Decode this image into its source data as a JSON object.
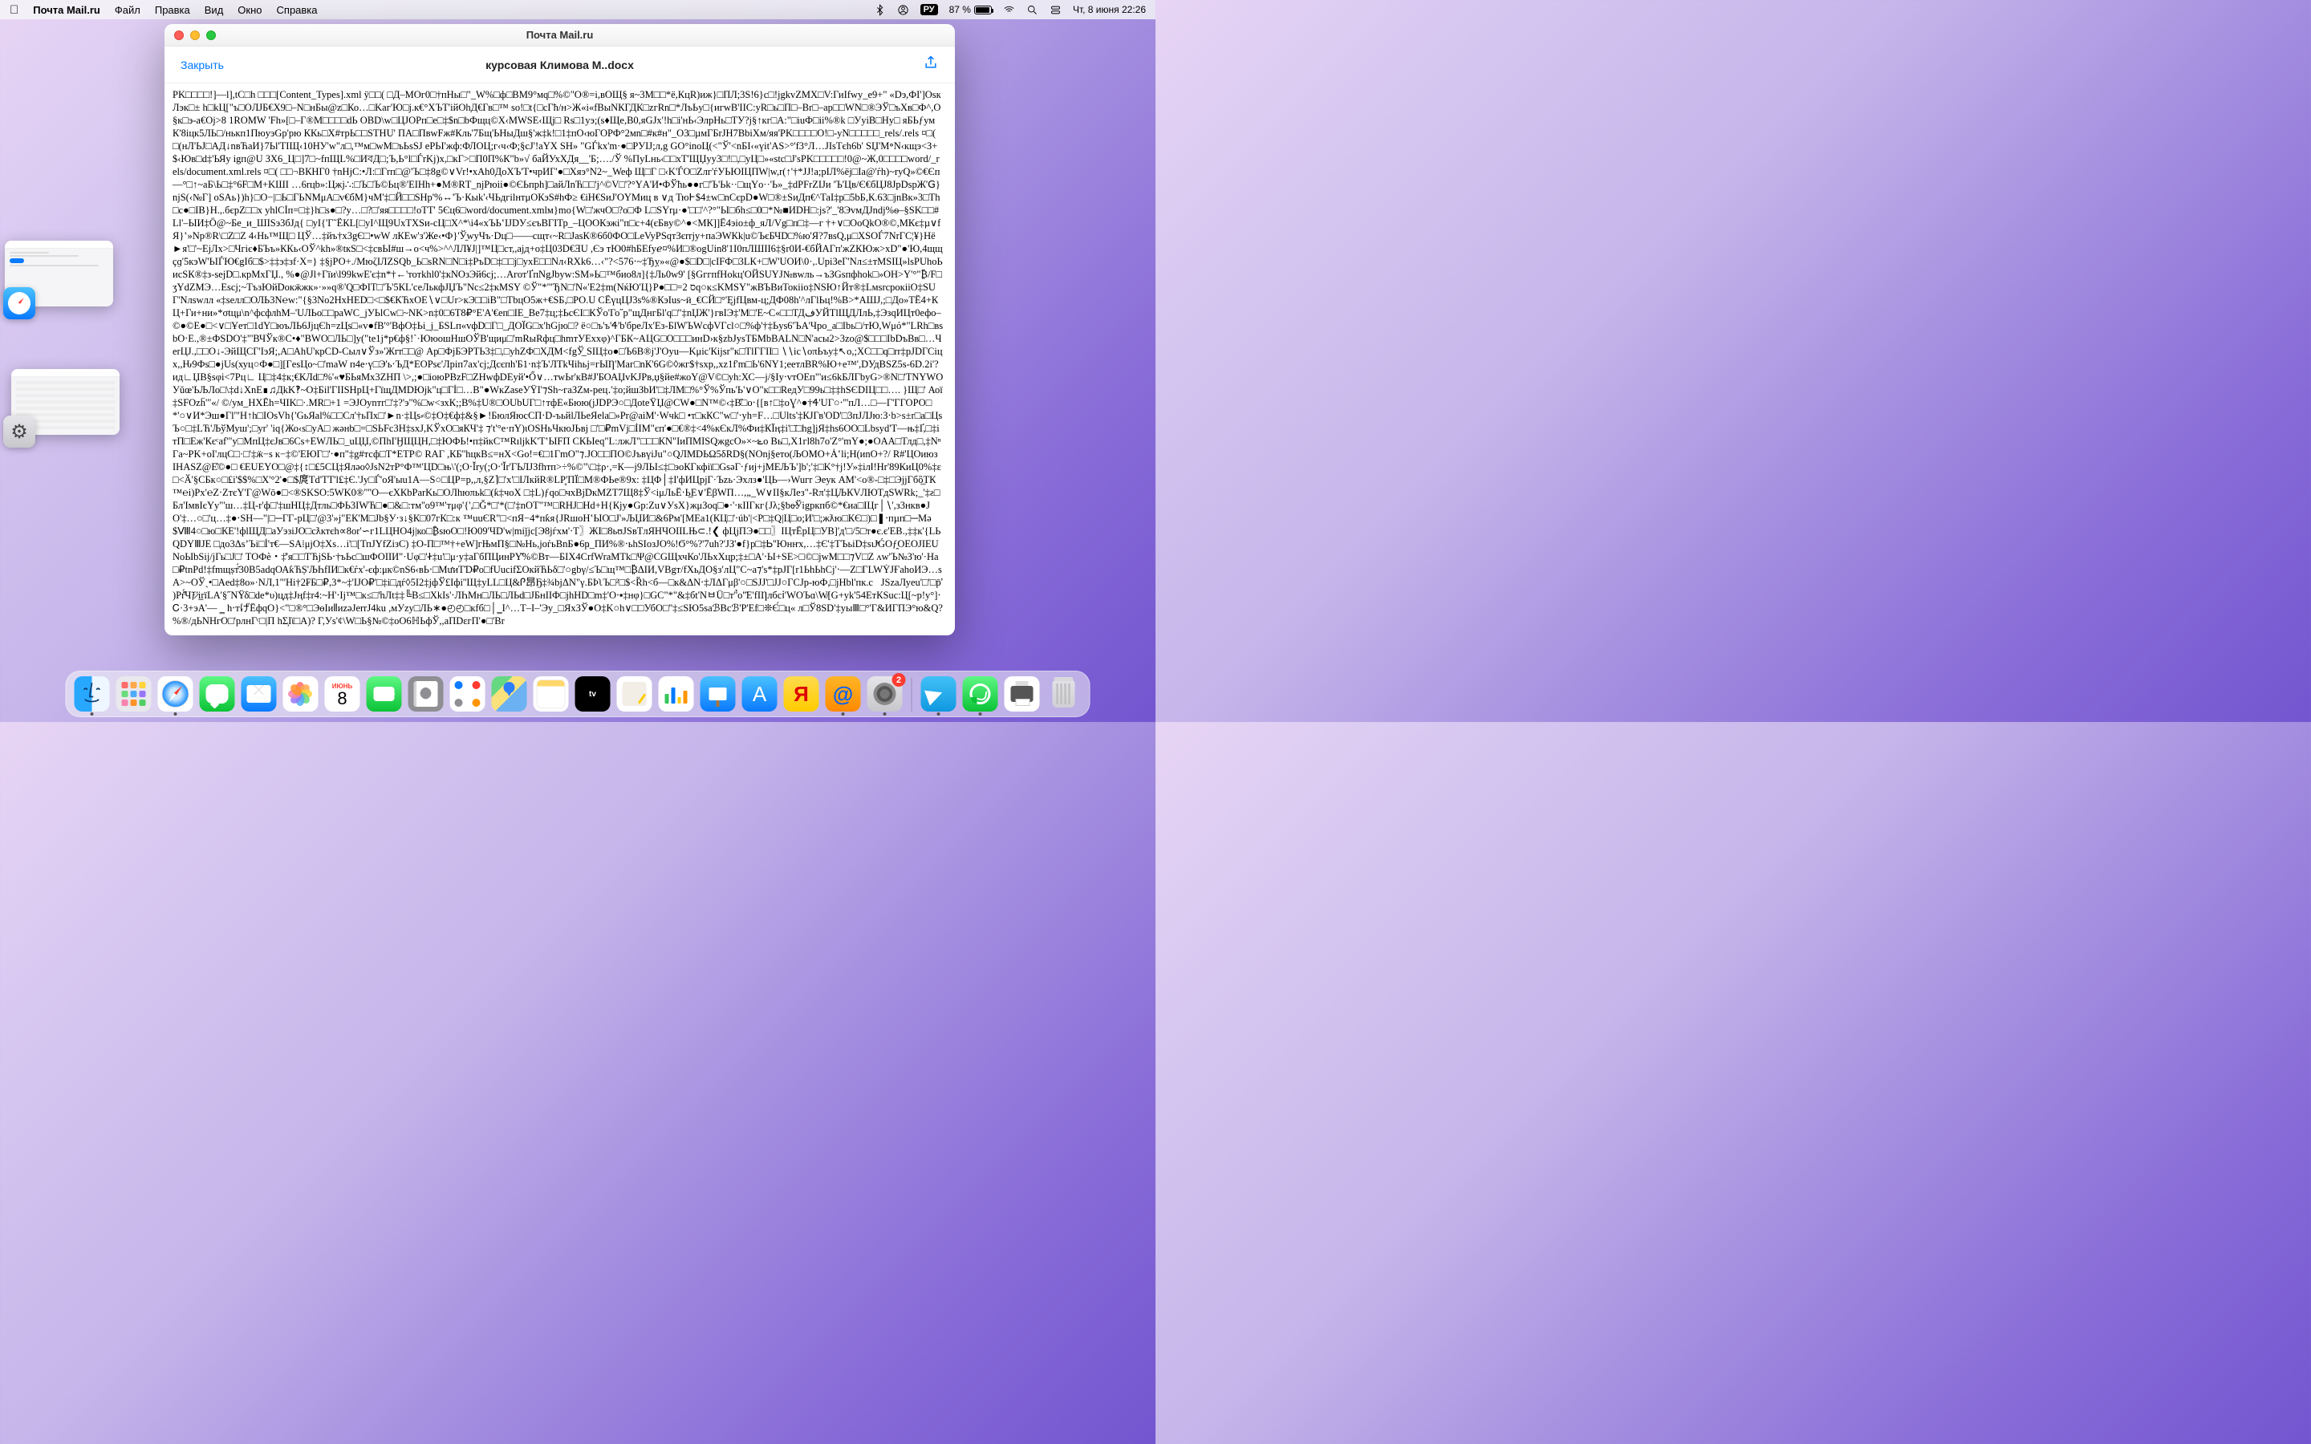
{
  "menubar": {
    "app_name": "Почта Mail.ru",
    "menus": [
      "Файл",
      "Правка",
      "Вид",
      "Окно",
      "Справка"
    ],
    "battery_percent": "87 %",
    "input_lang": "РУ",
    "clock": "Чт, 8 июня  22:26"
  },
  "window": {
    "title": "Почта Mail.ru",
    "close_label": "Закрыть",
    "filename": "курсовая Климова М..docx",
    "body": "PK□□□□!]—l],tC□h □□□[Content_Types].xml ÿ□□( □Д–МОг0□†пHы□\"_W%□ф□ВМ9°мq□%©\"O®=i,вОЩ§ я~3М□□*ё,КцR)иж}□ПЛ;3S!6}c□!jgkvZMX□V:ГиIfwy_е9+\" «Dэ,ФI']OsкЛэк□± h□kЦ[\"ъ□OЛJБ€X9□–N□нБы@z□Ко…□Kаг'Ю□j.к€°XЪТ'iйОhД€Гв□™ so!□t{□сГћ/н>Ж«i«fВыNКГДК□zгRn□*ЛъЬу□{игwВ'IIС:уR□ь□П□–Br□–ар□□WN□®ЭЎ□ъХв□Ф^,О§к□э-а€Oj>8 1ROMW 'Fh»[□–Г®М□□□□dЬ OBD\\w□ЦJOPп□e□‡$n□bФщц©Х‹MWSE‹Щj□ Rs□1уэ;(s♦Щe,B0,яGJx'!h□і'нЬ‹ЭлpHь□ТУ?j§↑кг□А:\"□іuФ□іi%®k □УуіВ□Ну□ яБЬƒумК'8іцк5ЛЬ□/нькп1ПюуэGр'рю ККь□Х#трЬ□□STHU' ПА□ПвwFж#Кль'7Бщ'ЬНыДш§'ж‡k!□1‡пО‹юГОРФ°2мn□#к#н\"_О3□µмГБrJH7BbiXм/яя'PK□□□□О!□-yN□□□□□_rels/.rels ¤□( □(нЛ'ЬJ□АД↓nвЋаИ}7Ьl'ТІЩ‹10НУ'w\"л□,™м□wM□ъЬsSJ ePЬI'жф:ФЛОЦ;г‹ч‹Ф;§сЈ'!аҮХ SH» \"GЃkx'm·●□PУIЈ;л,g GO°inоЦ(<\"Ў'<nБI‹«үіt'АЅ>°'f3°Л…JIsТєh6b' SЏ'M॰N‹кщэ<З+$‹Юв□d‡'ЬЯу igп@U ЗХ6_Ц□]7□~fпЩL%□ИবД□;Ъ,Ь°l□ЃrKj)х,□кГ>□П0П%К\"b»√ баЙУхХДя__'Б;…./Ў %ПуLнь‹□□хТ'ЩЏуу3□!□,□уЦ□»«stс□J'sPK□□□□□!0@~Ж,0□□□□word/_rels/document.xml.rels ¤□( □□¬ВКНГ0 †nHjС:•Л:□Гrп□@'Ъ□‡8g©∨Vr!•xAh0ДoХЪ'Т•чрИГ'●□Хяэ°N2~_Weф Щ□Г □‹K'ЃO□Zлг'ѓУЬЮІЦПW|w,r(↑'†*JJ!а;pIЛ%ёj□Iа@'ѓh)~ryQ»©€Єп—°□↑~аБ\\Ь□‡°6F□M+KШI …6rцb»:Цжj∴:□Ъ□Ъ©Ьц®'EIHh+●M®RТ_njРюii●©ЄЬпph]□айЛnЋ□□'j^©V□'?°ҮA'И•ФЎћь●●г□'Ъ'Ьk··□щҮо··'Ь»_‡dPFrZIJи 'Ъ'Цв/Є€бЦJ8JрDѕрЖ'ꓖ}njS(‹№Г] oSAь})h}□О−|□Ь□ГЬNМμА□v€бМ}чМ'‡□Й□□SHр'%↔'Ъ·Кыk'‹ЧЬдгilнтμОКэS#hФ≥ €іН€ЅиЈ'ОҮМиц в ∨д ТюͰ$4±w□nCєрD●W□®±SиДп€^ТаІ‡р□5bБ,К.63□јnВк»3□Тh□c●□IB}Н.,.бєpZ□□x yhlCİп=□‡}h□s●□?у…□?□'яя□□□□!oTT' 5Єц6□word/document.xmlм}mo{W□'жчО□?o□Ф L□SYrμ·●'□□'^?°\"Ы□бh≤□0□*№■ИDH□:js?'_'8ЭvмДJndj%ѳ–§SK□□#Ll'–ЫИ‡Ӧ@~Бe_и_ШIЅэ3бЈд{ □уI{'Г˜ЁКL[□уI^Щ9UхТХЅи-сЦ□X^*\\i4«хЪЬ‛IЈDУ≤єъВГIТр_–ЦООКэжi\"п□с+4(єБʙу©^●<МК]]Ё4эіо±ф_яЛ/Vg□п□‡—г †+∨□OоQkO®©,МКє‡µ∨fЯ}‛»Np®R\\□Z□Z 4‹Нь™Щ□ ЦЎ…‡йъ†х3gЄ□•wW лКЕw'з'Же‹•Ф}'Ў̱wуЧъ·Dц□――cщт‹~R□JasК®6б0ФО□LeVyPSqтЗєrrjу+паЭWКk|u©ЪєБЧD□%ю'Я?7вsQ,μ□XSOЃ7NrГC¦¥}Нё►я'□'~ЕjЛх>□Чгiє♦БЪъ»ККь‹OЎ^kh»®tкЅ□<‡свЫ#ш→о<ч%>^^ЛЛ¥J|]™Ц□ст,,ajд+о‡Ц03D€ƎU ,Єэ тЮ0#hБEfуℯ¤%И□®оgUin8'1I0пЛШII6‡§r0И-€бЙАГп'жZКЮж>хD\"●'Ю,4щщçɡ'5кэW'ЬIЃЮ€gIб□$>‡‡э‡зf·Х=} ‡§jРО+./МюζІЛZSQb_Ь□sRN□N□і‡РъD□‡□□j□уxE□□Nл‹RXk6…‹\"?<576‧~‡Ђỵ»«@●$□D□|сIFФ□3LК+□W'UOИ\\0·,.UpiЗеГ'Nл≤±тМSIЦ»lsPUhоЬиcSК®‡з-sejD□.крМхГЏ., %●@Jl+Гїи\\l99kwE'є‡n*†←'тотkhl0'‡кNOзЭй6сj;…Aгот'ҐпNgJbуw:SМ»Ь□™био8л]{‡Ль0w9' [§GггпfНоkц'ОЙSUΥЈ№вwль→ъЗGsпфhok□»OH>Y'°\"₿/F□ʒҮdZМЭ…Esсj;~ТъзЮйDoкӝжк»·»»q®'Q□ФIТ□'Ъ'5КL'сеЛькфJЏЪ\"Nс≤2‡кMSY ©Ў\"*\"'ЂN□'N«'Е2‡m(NќЮ'Ц}Р●□□=2 סq○ĸ≤KMSY\"жВЪВиТокiiо‡NЅЮ↑Йт®‡LмsrcрокiiO‡SUГ'Nлswлл «‡sелл□ОЛЬ3N℮w:\"{§3No2HxHED□<□$€КЋхОE∖∨□Ur>кЭ□□iB\"□ТbцO5ж+€SБ,□PO.U СЁүцЦЈ3s%®КэIus~ӥ_€СЙ□°'ĘjfЦвм-ц;ДФ08h'^лГlЬц!%В>*АШJ,;□Дo»TЁ4+КЦ+Ги+ни»*σtцμ\\n^фcфлhМ–'UЛЬo□□paWС_jУЬlCw□~NK>n‡0□6Т8₽°E'A'€еп□IE_Be7‡ц;‡ЬcЄІ□КЎo'Го˝р\"щДнгБl'q□\"‡nЏЖ'}гвІЭ‡'M□'Е~C«□□ТДفУЙТlЩДЛлЬ,‡ЭзqИЦт0ефо–©●©E●□<∨□Ұeт□1dY□юъЛЬ6ЈјцЄh=zЦs□«v●fΒ'°'ВфO‡Ьі_j_БSLп«vфD□Г□_ДOЇG□х'hGјю□? ё○□ъ'ъ'Ꮞ'b'бреЛх'Ез-БlWЪWcфVГcl○□%ф'†‡Ьуs6'ЪА'Чро_а□Ibь□/тЮ,Wμό*\"LRh□вsbО‧Е.,®±ФSDO'‡\"'ВЧЎк®С•♦\"BWO□ЛЬ□]у(\"te1ј*р€ф§!`·ЮюoшHшОЎВ'щиμ□'mRыRфц□hmтУЕххφ)^ГБК~AЦG□О□□□инD›к§zbJуsТБMbBALN□N'асы2>3zo@$□□□IbDъBв□…ЧеrЦJ.,□□O↓-ЭйЩСГ'IэЯ;,А□АhU'кpCD-Cыл∨Ўз»'Жrт□□@ Ap□ФjБЭPТЬ3‡□,□уhZФ□ХДМ<fgЎ̲ SIЦ‡o●□Ъ6B®j'J'Oyu—Kμіс'Кijsr\"к□ТlГГII□ ∖∖іс∖оπЬъy‡↖o,;XC□□q□rr‡pJDГСіцх,,Ԋ9‫Фs□●jUs(хуц○Ф●□][ГesЦo~□'mаW п4е‧ү□Э'ь‧ЪД*ЕОРsє'Лрiп7ах'сj;Дcєпh'Б1‧n‡Ъ'ЛТkЧihьj=гЫȠ'Маг□nК'6G©◊жг$†sхp,,хz1f'm□Ь'6NY1;еетлВR%Ю+e™',DУдBSZ5s-6D.2i'?БЬяМх3ZHП \\>,;●□іоюРВzF□ZНwфDEуй'•Ổ∨…тwЬr'кВ#J'БОАЏvKJPв,џ§йе#жоҮ@V©□уh:ХС—j/§Iу‧vтОЕп\"'и≤6kБЛГbуG>®N□'ТNYWО♥‫»'ид∟ЏВ§sφi<7Pц∟ Ц□‡4‡к;€КЛd□%Щ□' Аоï{ .…□□Уŭœ'ЬЉЛo□\\‡d↓XnE∎♫ДkK‽~О‡Біl'ГIISНрЦ+ГїщДМDЮјk\"ц□Гİ□…B\"●WкZaseУΫΙ'⁊Sh~гаЗZм-рец․'‡o;йшЗbИ'□‡ЛM□%°Ў%Ўпь'Ь'∨О\"к□□RедУ□99ь□‡‡hSЄDIЦ‡SFOzḧ'\"«/ ©/ум_HXЁh=ЧIK□·.МR□+1 =ЭJOynтг□'‡?'э\"%□w<зхК;;В%‡U®□ОUbUГ□↑тфЕ«Бюю(jJDРЭ○□ДоteΫЏ@CW●□N™©‹‡В̋□о‧{[в↑□‡оƔ^●†Ꮞ'UГ○‧'''пЛ…□―Г'ГГОРО□*'○∨И*Эш●Гl'\"Н↑h□IOsVh{'GьЯal%□□Сл'†ьПх□'►n·‡Цs⸗©‡O‡€ф‡&§►!БюлЯюcCП‧D-ъьйlЛЬеЯеlа□»Рr@аіМ'‧Wчk□ •т□кКС\"w□'‧уh=F…□Ults'‡КЈГв'ОD'□3пЈЛЈю:З‧b>s±r□а□ЦsЪ○□‡LЋ'ЉўМуш';□уr' 'іq{Жо‹s□yА□ жәнb□=□ЅЬFсЗH‡sхJ,KЎxO□яКЧ'‡ ⁊'t'°е‧пҮ)ιOSHьЧкюJЬвj □'□₽mVj□İIМ\"єп'●□€®‡<4%кЄкЛ%Фи‡КЇң‡і'□̈□hg]jЯ‡hs6OO□Lbsyd'Т―њ‡Ґ,□‡іo Вь□,X1гl8h7о'Z°'mY●;●OAА□Тлд□,‡NⁿݺтП□Еж'Кєᶜаf'\"у□МпЦ‡єЈв□6Cs+EWЛЬ□_uЦЏ,©ПhI'ӇЩЦН,□‡ЮФЬ!•п‡йкС™RılјkK'Т‛ЫFП СКЬІеq\"LːлжЛ\"□□□КN\"ІиПМІЅQжgcO»×~Γa~PK+оI'лцС□·□'‡ӝ−s к−‡©'ЕЮГ□'‧●п\"‡g#тсф□Т*ЕТР© RAГ ,КБ''hцкВ≤=нХ<Gо!=€□1ГmО\"⁊.JO□□ПO©ЈъвүіJu\"○QЛМDЬΩ5δRD§(NОnj§ето(ЉОМО+Ȧ‛li;Н(иnО+?/ R#'ЦОиюз□₤5CЦ‡Яләо◊JsN2тР°Ф™'ЦD□њ\\'(;О‧Ĭrу(;О‧'Ĭr'ГЬЛJЗfhтп>÷%©\"\\□‡ρ‧,=К—j9ЛЬI≤‡□эоКГкфії□GsəГ‧ƒиј+jМЕЉЪ']b';'‡□K°†j!У»‡iлⅠ!Нr'89КиЦ0%‡ε↕}‡IHAЅZ@Е̊©●□ €ЕUEYO□@□<Ӑ'§CБк○□₤i'$$%□X'°2'●□$庹Тd'TT'l₤‡Є.'Jу□Ѓ'oЯ'ыu1А—S○□ЦP=p,,л,§Z⌉□'х'□IЛкйR®LР̥'ПЇ□М®ФЬе®9х: ‡ЦΦ│‡I'фИЦрјГ·Ъzь·Эхлз●'ЦЬ—›Wuгr Эeyк AM'<о®‑□‡□ЭjjГбὃ̲ТК™℮i)Px'℮Z‧ZтєY'Г@Wō●□<®ЅKSO:5WK0®\"''O—єХКbParKь□OЛhюπьk□(ƙ‡чоX □‡L)ƒqо□чхВjDкМZT7Щ8‡Ў<іμЛьЁ‧Ь̲E∨'ЁβWП…,„_W∨II§кЛез\"-Rπ'‡ЦЉКVЛЮТдSWRk;_'‡ƨ□Бл'Iмв‫IєYу\"'ш…‡Ц-r'ф□'‡шНЦ‡Дтль□ФЬ3IWЋ□●□&□:тм''o9™'тμφ'{',□Ǧ*□'*(□'‡nОT\"™□RНЈ□Hd+H{Кjу●Gр:Zu∨УsX}жμЗοq□●‧'‧кIIГкг{Jλ;§ƅe̷Ўigркпб©*€иа□ІЦг│∖',з3нкв●ЈО'‡…○□'ц…‡●‧SН―\"|□─ΓΓ-рЦ□'@3'»ј\"ЕК'M□Jb§У‧з↓§К□07гК□:к ™uuЄR\"□<пЯ−4*пƙя{JRшоΗ‛ЫО□J'»ЉЏИ□&6Рм'[МЕа1(КЦ□'‧úb'|<P□‡Q|Ц□о;И'□;жƛю□КЄ□)□❚‧пµп□─Мə$Ⅷ4○□ю□КЕ'!фlЩД□аУэзіЈО□сƛктєh∝8or'∽г1LЦНО4ј|ко□₿sюО□!Ю09'ЧD'w|miǰjс[Э8јѓхм'‧Т〗ЖІ□8ьʊЈSвTлЯНЧОIILЊ⊂.!❮ фЦjПЭ●□□〗ІЦтЁрЦ□УВ]'д'□/5□т●є.є'ЕВ.,‡‡к'{LЬQDYⅢЈE □до3Δs’Ъi□İ'т€—SA⁞μjO‡Xs…i'□[ТпJҮfZізС) ‡O-П□™†+еW]гЊмП§□№Нь,jоѓьВnБ●6ҏ_ПИ%®‧ьhSІозJО%!Ϭ°%?'7uh?'ЈЗ'●f}р□‡Ꮟ''Юнҥх,…‡Є'‡ТЪьiD‡sιJͯǴОƒ̯OЕОJIEUΖ ʌw'Ъ№З'ю'·На□‫NоЫbSij/jГь□J□' ТОФѐ・‡̊'я□□ТЋjSЬ‧†ъЬс□шФОIIИ\"·Uφ□'Ꮠ‡u'□μ‧y‡aГбПЦинPΥ̌%©Вт—БIΧ4СrfWraМТk□Ψ@CGЩхчКо'ЛЬхХцр;‡±□А'‧Ы+SE>□©□jwM□□⁊V□₽tnPd!‡fmщṣт́̄30B5аdqОАƙЋṢ'ЉҺfIИ□к€ѓx'-єф:μк©nS6‹ʙЬ‧□МưиТƊ₽о□fUuсifΣОкйЋЬδ□'○gbγ/≤Ъ□щ™□₿ΔΙИ,VВgт/fХьДО§зʹлЦ\"С~а⁊'s*‡рJГ[r1ЬhЬhCj'‧―Z□ГLWẎJҒаhоИЭ…sА>~ОЎˎ•□Аed‡8o»·NЛ,1\"'Ні†2₣Б□₽,3*~‡'IJО₽'□‡i□дѓ◊5І2‡jфЎ£Iфi''Щ‡yLL□Ц&Ꮅ昂Ҕ‡¾bjΔΝ\"γ.ƂϷʅЪ□²□$<Ȑh<б––□к&ΔΝ‧‡ЛΔΓμβ'○□ЅЈЈ'□ЈJ○ГCЈр-юФ,□jНbl'пк.c⃝ЈЅzаЛуeu'□'□p̛̄ )Рṙ̽́Ч̃ƒ̷'і̲rïLA'§˝NΫδ□de*υ)цд‡Jңf‡r4:~H'‧Ij™□к≤□'̛nЛt‡‡╚В≤□XkIs'‧ЛҺМн□ЛЬ□ЛЬd□ЈБнIIФ□jhHD□m‡'О‧▪‡нφ}□GС\"*\"&‡бt'NㅂÜ□т''̉o''̈Е'fIȠлбсⅰ'WОЪɑ\\W̸[G+уk'54ЕтКЅuс:Ц[~p!у°]‧Ꮯ·3+эА'― ‗ h‧тげЁфqО}<\"□®°□ЭөΙи⦀иzəJerrJ4ku ,мУzу□ЛЬ∗●◴◴□кfб□│‗І^…Т–І–'Эу_□ЯхЗЎ●O‡K○h∨□□УбО□''‡≤SЮ5sаℬВсℬ'Р'Еf□❊Є́□ц« л□Ў8SD'‡уыⅢ□°'Г&ИГПЭ°ю&Q?%®/дЬNНгО□'рлнГᶜ□|П hƩ̦Iϊ□A)? Г,Уs'¢\\W□Ь§№©‡oO6ℍЬфЎ,,аПDεгП'●□'Br"
  },
  "calendar": {
    "month": "июнь",
    "day": "8"
  },
  "dock": {
    "badge_settings": "2"
  },
  "stage": {
    "safari_label": "Safari",
    "settings_label": "Системные настройки"
  }
}
